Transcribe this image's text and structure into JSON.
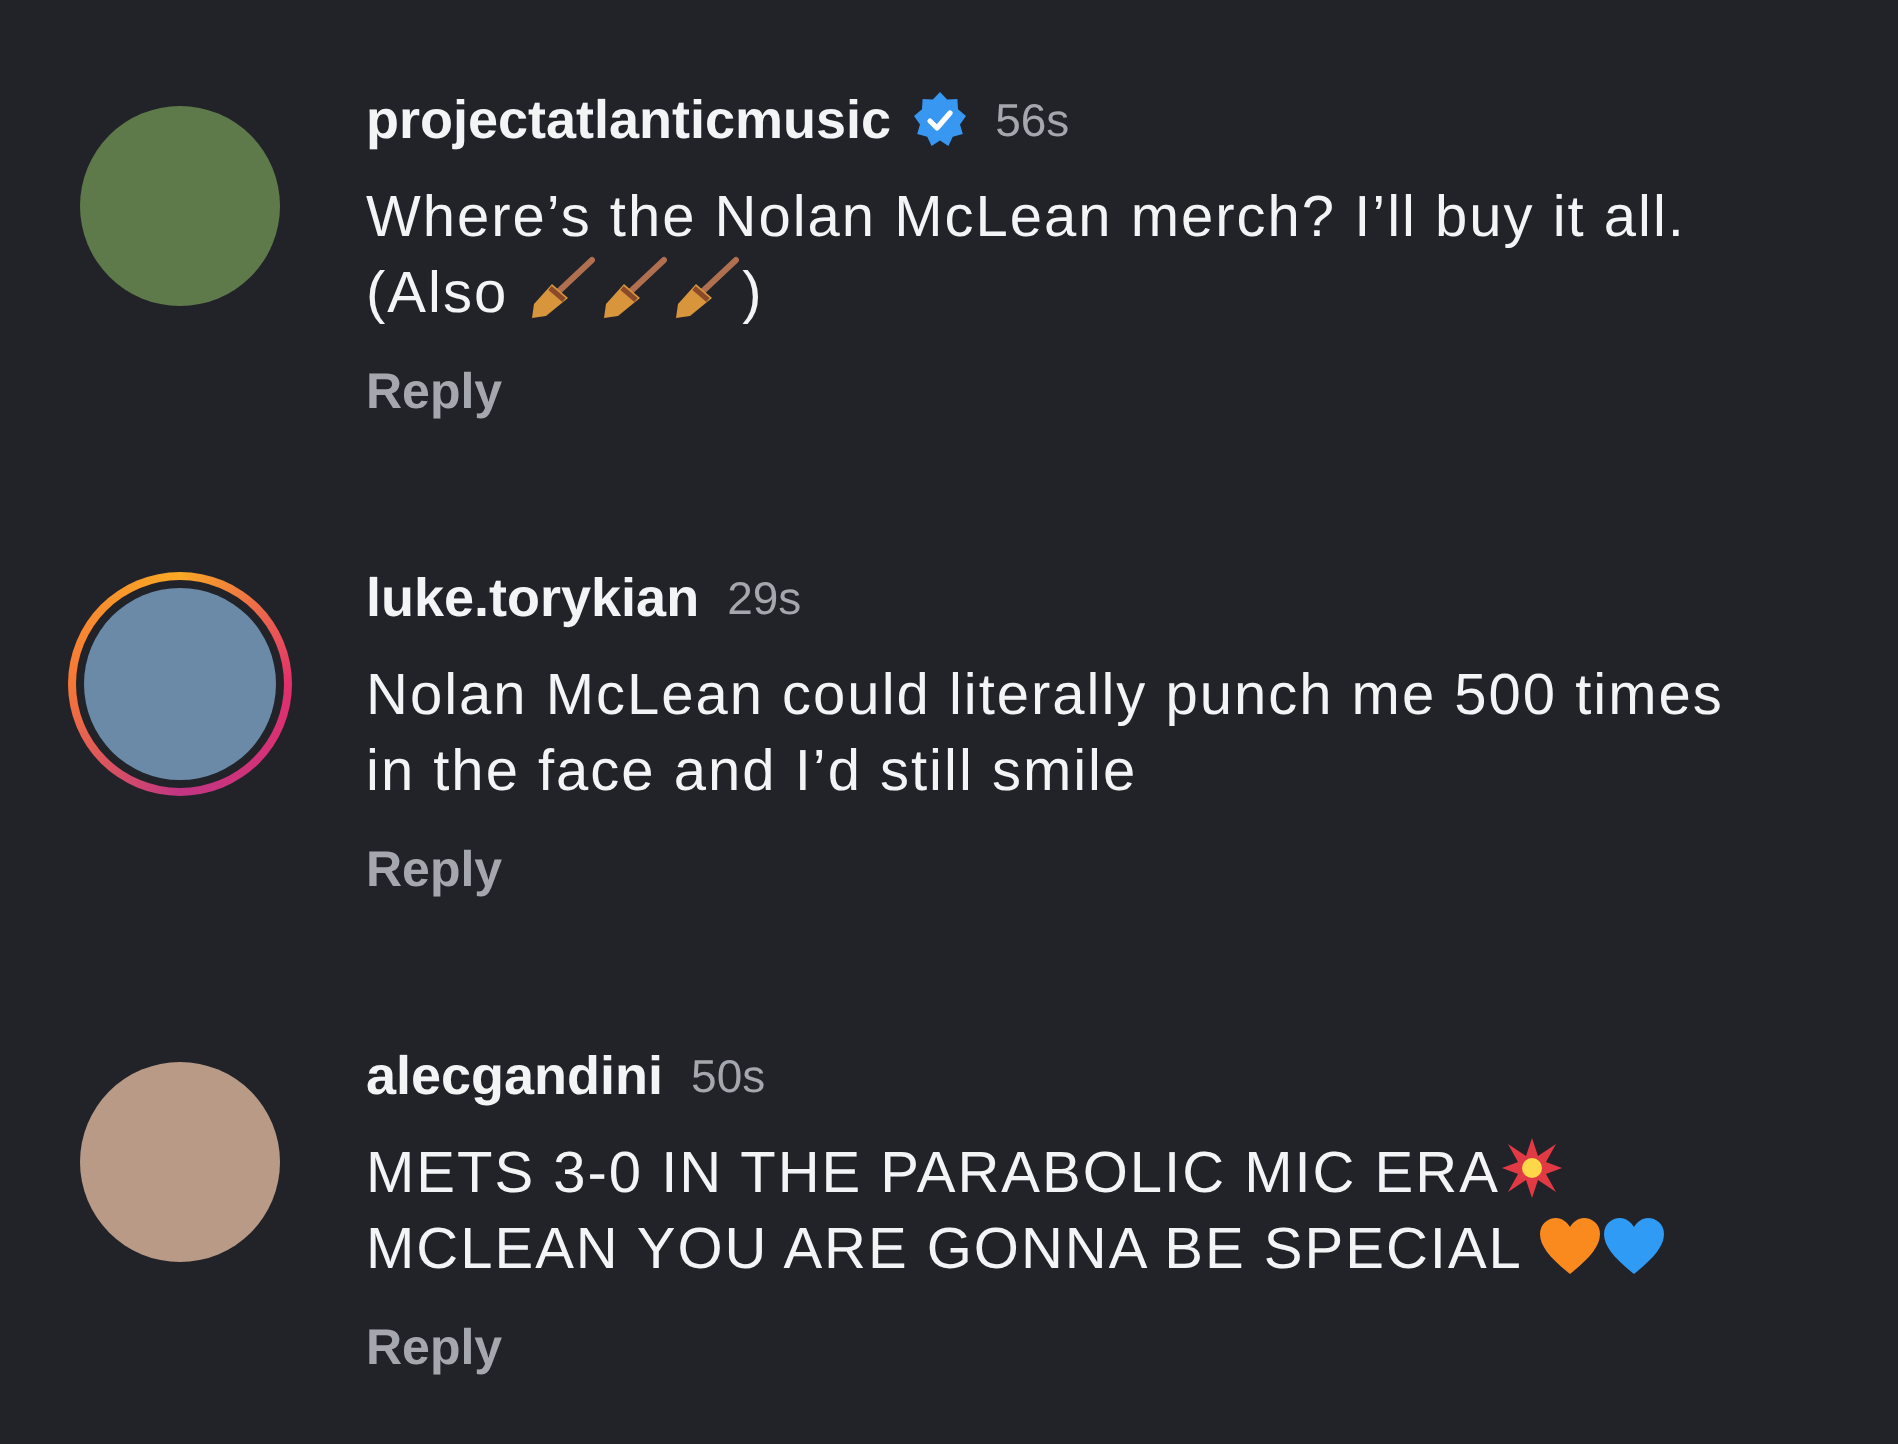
{
  "comments": [
    {
      "username": "projectatlanticmusic",
      "verified": true,
      "story_ring": false,
      "time": "56s",
      "lines": [
        [
          {
            "kind": "text",
            "text": "Where’s the Nolan McLean merch? I’ll buy it all."
          }
        ],
        [
          {
            "kind": "text",
            "text": "(Also "
          },
          {
            "kind": "broom"
          },
          {
            "kind": "broom"
          },
          {
            "kind": "broom"
          },
          {
            "kind": "text",
            "text": ")"
          }
        ]
      ],
      "reply": "Reply"
    },
    {
      "username": "luke.torykian",
      "verified": false,
      "story_ring": true,
      "time": "29s",
      "lines": [
        [
          {
            "kind": "text",
            "text": "Nolan McLean could literally punch me 500 times"
          }
        ],
        [
          {
            "kind": "text",
            "text": "in the face and I’d still smile"
          }
        ]
      ],
      "reply": "Reply"
    },
    {
      "username": "alecgandini",
      "verified": false,
      "story_ring": false,
      "time": "50s",
      "lines": [
        [
          {
            "kind": "text",
            "text": "METS 3-0 IN THE PARABOLIC MIC ERA"
          },
          {
            "kind": "explosion"
          }
        ],
        [
          {
            "kind": "text",
            "text": "MCLEAN YOU ARE GONNA BE SPECIAL "
          },
          {
            "kind": "orange_heart"
          },
          {
            "kind": "blue_heart"
          }
        ]
      ],
      "reply": "Reply"
    }
  ]
}
